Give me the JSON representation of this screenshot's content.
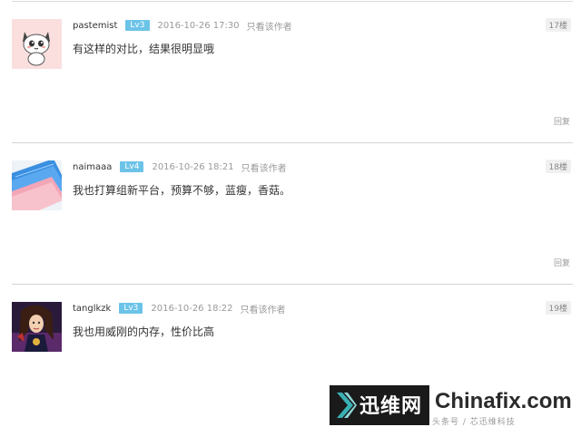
{
  "posts": [
    {
      "username": "pastemist",
      "level": "Lv3",
      "time": "2016-10-26 17:30",
      "only_author": "只看该作者",
      "floor": "17楼",
      "content": "有这样的对比，结果很明显哦",
      "reply": "回复",
      "avatar_icon": "cartoon-cat-icon"
    },
    {
      "username": "naimaaa",
      "level": "Lv4",
      "time": "2016-10-26 18:21",
      "only_author": "只看该作者",
      "floor": "18楼",
      "content": "我也打算组新平台，预算不够，蓝瘦，香菇。",
      "reply": "回复",
      "avatar_icon": "smartphone-icon"
    },
    {
      "username": "tanglkzk",
      "level": "Lv3",
      "time": "2016-10-26 18:22",
      "only_author": "只看该作者",
      "floor": "19楼",
      "content": "我也用威刚的内存，性价比高",
      "avatar_icon": "anime-character-icon"
    }
  ],
  "watermark": {
    "brand_cn": "迅维网",
    "brand_en": "Chinafix.com",
    "small_text": "头条号 / 芯迅维科技"
  },
  "colors": {
    "level_badge": "#6cc3e8",
    "separator": "#d4d4d4",
    "muted_text": "#999999",
    "watermark_teal": "#3ab0b4"
  }
}
